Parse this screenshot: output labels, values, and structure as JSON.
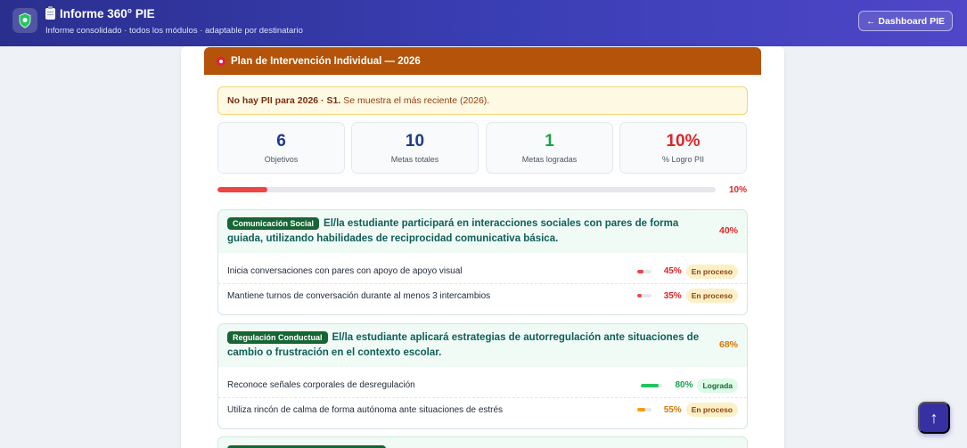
{
  "header": {
    "title": "Informe 360° PIE",
    "subtitle": "Informe consolidado · todos los módulos · adaptable por destinatario",
    "dashboard_button": "← Dashboard PIE"
  },
  "section": {
    "title": "Plan de Intervención Individual — 2026",
    "notice_bold": "No hay PII para 2026 · S1.",
    "notice_text": "Se muestra el más reciente (2026)."
  },
  "stats": [
    {
      "value": "6",
      "label": "Objetivos",
      "color": "#1e3a8a"
    },
    {
      "value": "10",
      "label": "Metas totales",
      "color": "#1e3a8a"
    },
    {
      "value": "1",
      "label": "Metas logradas",
      "color": "#16a34a"
    },
    {
      "value": "10%",
      "label": "% Logro PII",
      "color": "#dc2626"
    }
  ],
  "overall_progress": {
    "percent": 10,
    "label": "10%"
  },
  "goals": [
    {
      "tag": "Comunicación Social",
      "text": "El/la estudiante participará en interacciones sociales con pares de forma guiada, utilizando habilidades de reciprocidad comunicativa básica.",
      "pct": "40%",
      "metas": [
        {
          "label": "Inicia conversaciones con pares con apoyo de apoyo visual",
          "percent": 45,
          "pct": "45%",
          "status": "En proceso"
        },
        {
          "label": "Mantiene turnos de conversación durante al menos 3 intercambios",
          "percent": 35,
          "pct": "35%",
          "status": "En proceso"
        }
      ]
    },
    {
      "tag": "Regulación Conductual",
      "text": "El/la estudiante aplicará estrategias de autorregulación ante situaciones de cambio o frustración en el contexto escolar.",
      "pct": "68%",
      "metas": [
        {
          "label": "Reconoce señales corporales de desregulación",
          "percent": 80,
          "pct": "80%",
          "status": "Lograda"
        },
        {
          "label": "Utiliza rincón de calma de forma autónoma ante situaciones de estrés",
          "percent": 55,
          "pct": "55%",
          "status": "En proceso"
        }
      ]
    }
  ],
  "colors": {
    "header_bg": "#3b3fb6",
    "section_bg": "#b45309",
    "red": "#dc2626",
    "orange": "#d97706",
    "green": "#16a34a",
    "teal": "#115e59"
  }
}
